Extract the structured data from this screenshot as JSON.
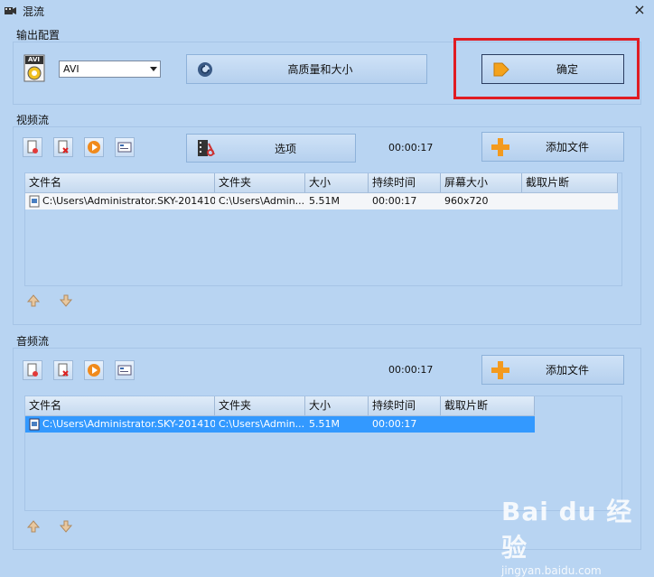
{
  "window": {
    "title": "混流"
  },
  "output": {
    "section_label": "输出配置",
    "format_value": "AVI",
    "format_badge": "AVI",
    "quality_button": "高质量和大小",
    "ok_button": "确定"
  },
  "video": {
    "section_label": "视频流",
    "options_button": "选项",
    "time": "00:00:17",
    "add_file_button": "添加文件",
    "columns": [
      "文件名",
      "文件夹",
      "大小",
      "持续时间",
      "屏幕大小",
      "截取片断"
    ],
    "rows": [
      [
        "C:\\Users\\Administrator.SKY-201410...",
        "C:\\Users\\Admin...",
        "5.51M",
        "00:00:17",
        "960x720",
        ""
      ]
    ]
  },
  "audio": {
    "section_label": "音频流",
    "time": "00:00:17",
    "add_file_button": "添加文件",
    "columns": [
      "文件名",
      "文件夹",
      "大小",
      "持续时间",
      "截取片断"
    ],
    "rows": [
      [
        "C:\\Users\\Administrator.SKY-201410...",
        "C:\\Users\\Admin...",
        "5.51M",
        "00:00:17",
        ""
      ]
    ]
  },
  "watermark": {
    "brand": "Bai du 经验",
    "url": "jingyan.baidu.com"
  },
  "colors": {
    "window_bg": "#b8d4f2",
    "selection": "#3399ff",
    "highlight_box": "#e01b22",
    "add_icon": "#f39a1e"
  }
}
